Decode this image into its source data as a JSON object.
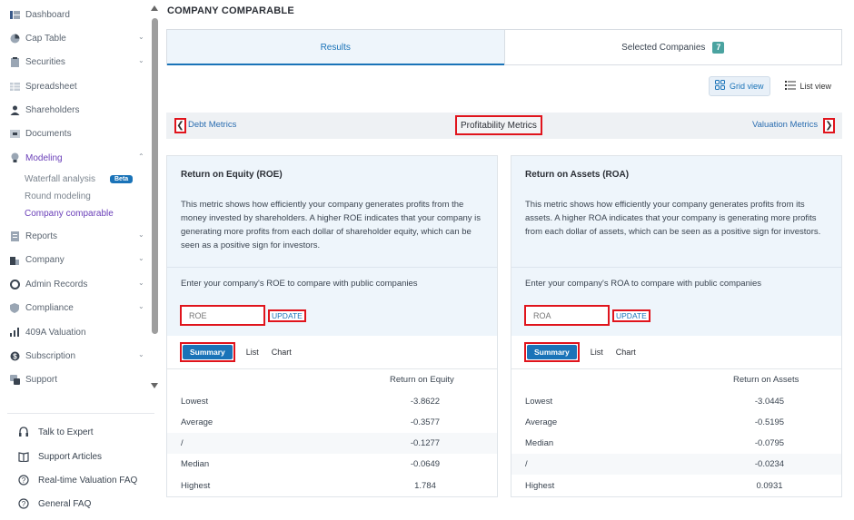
{
  "sidebar": {
    "items": [
      {
        "label": "Dashboard",
        "icon": "dashboard-icon",
        "chevron": false
      },
      {
        "label": "Cap Table",
        "icon": "pie-chart-icon",
        "chevron": true
      },
      {
        "label": "Securities",
        "icon": "clipboard-icon",
        "chevron": true
      },
      {
        "label": "Spreadsheet",
        "icon": "table-icon",
        "chevron": false
      },
      {
        "label": "Shareholders",
        "icon": "user-icon",
        "chevron": false
      },
      {
        "label": "Documents",
        "icon": "folder-icon",
        "chevron": false
      },
      {
        "label": "Modeling",
        "icon": "lightbulb-icon",
        "chevron": true,
        "expanded": true,
        "active": true
      },
      {
        "label": "Reports",
        "icon": "report-icon",
        "chevron": true
      },
      {
        "label": "Company",
        "icon": "building-icon",
        "chevron": true
      },
      {
        "label": "Admin Records",
        "icon": "records-icon",
        "chevron": true
      },
      {
        "label": "Compliance",
        "icon": "shield-icon",
        "chevron": true
      },
      {
        "label": "409A Valuation",
        "icon": "chart-icon",
        "chevron": false
      },
      {
        "label": "Subscription",
        "icon": "subscription-icon",
        "chevron": true
      },
      {
        "label": "Support",
        "icon": "support-icon",
        "chevron": false
      }
    ],
    "modeling_sub": [
      {
        "label": "Waterfall analysis",
        "badge": "Beta"
      },
      {
        "label": "Round modeling"
      },
      {
        "label": "Company comparable",
        "active": true
      }
    ],
    "help": [
      {
        "label": "Talk to Expert",
        "icon": "headset-icon"
      },
      {
        "label": "Support Articles",
        "icon": "book-icon"
      },
      {
        "label": "Real-time Valuation FAQ",
        "icon": "question-circle-icon"
      },
      {
        "label": "General FAQ",
        "icon": "question-circle-icon"
      }
    ]
  },
  "page": {
    "title": "COMPANY COMPARABLE",
    "tabs": {
      "results": "Results",
      "selected": "Selected Companies",
      "selected_count": "7"
    },
    "view": {
      "grid": "Grid view",
      "list": "List view"
    },
    "metrics": {
      "prev": "Debt Metrics",
      "current": "Profitability Metrics",
      "next": "Valuation Metrics"
    }
  },
  "cards": [
    {
      "title": "Return on Equity (ROE)",
      "description": "This metric shows how efficiently your company generates profits from the money invested by shareholders. A higher ROE indicates that your company is generating more profits from each dollar of shareholder equity, which can be seen as a positive sign for investors.",
      "prompt": "Enter your company's ROE to compare with public companies",
      "input_placeholder": "ROE",
      "update_label": "UPDATE",
      "subtabs": [
        "Summary",
        "List",
        "Chart"
      ],
      "column_header": "Return on Equity",
      "rows": [
        {
          "label": "Lowest",
          "value": "-3.8622"
        },
        {
          "label": "Average",
          "value": "-0.3577"
        },
        {
          "label": "/",
          "value": "-0.1277"
        },
        {
          "label": "Median",
          "value": "-0.0649"
        },
        {
          "label": "Highest",
          "value": "1.784"
        }
      ]
    },
    {
      "title": "Return on Assets (ROA)",
      "description": "This metric shows how efficiently your company generates profits from its assets. A higher ROA indicates that your company is generating more profits from each dollar of assets, which can be seen as a positive sign for investors.",
      "prompt": "Enter your company's ROA to compare with public companies",
      "input_placeholder": "ROA",
      "update_label": "UPDATE",
      "subtabs": [
        "Summary",
        "List",
        "Chart"
      ],
      "column_header": "Return on Assets",
      "rows": [
        {
          "label": "Lowest",
          "value": "-3.0445"
        },
        {
          "label": "Average",
          "value": "-0.5195"
        },
        {
          "label": "Median",
          "value": "-0.0795"
        },
        {
          "label": "/",
          "value": "-0.0234"
        },
        {
          "label": "Highest",
          "value": "0.0931"
        }
      ]
    }
  ],
  "colors": {
    "accent": "#1a73b8",
    "active_nav": "#6a3fb8",
    "highlight_border": "#e0141c",
    "badge": "#4aa3a0"
  }
}
